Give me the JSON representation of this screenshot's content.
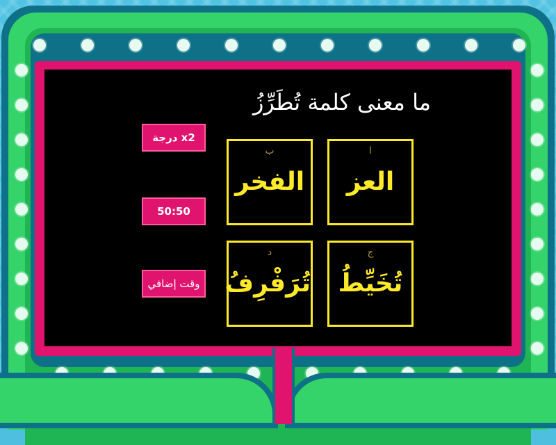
{
  "question": "ما معنى كلمة تُطَرِّزُ",
  "answers": [
    {
      "letter": "ا",
      "text": "العز"
    },
    {
      "letter": "ب",
      "text": "الفخر"
    },
    {
      "letter": "ج",
      "text": "تُخَيِّطُ"
    },
    {
      "letter": "د",
      "text": "تُرَفْرِفُ"
    }
  ],
  "powerups": {
    "double": "x2 درجة",
    "fifty": "50:50",
    "extra_time": "وقت إضافي"
  },
  "colors": {
    "screen": "#000000",
    "answer_border": "#ffea2a",
    "frame_pink": "#e0136e",
    "frame_green": "#34d46a",
    "frame_dark": "#0f7187"
  }
}
